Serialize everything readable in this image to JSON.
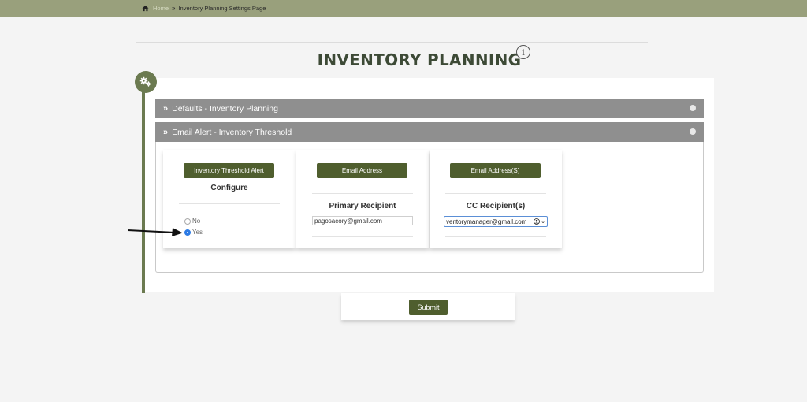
{
  "breadcrumb": {
    "home_label": "Home",
    "separator": "»",
    "current_label": "Inventory Planning Settings Page"
  },
  "page": {
    "title": "INVENTORY PLANNING",
    "info_glyph": "i"
  },
  "accordions": [
    {
      "label": "Defaults - Inventory Planning",
      "chevron": "»"
    },
    {
      "label": "Email Alert - Inventory Threshold",
      "chevron": "»"
    }
  ],
  "columns": {
    "configure": {
      "button_label": "Inventory Threshold Alert",
      "title": "Configure",
      "options": [
        {
          "label": "No",
          "selected": false
        },
        {
          "label": "Yes",
          "selected": true
        }
      ]
    },
    "primary": {
      "button_label": "Email Address",
      "title": "Primary Recipient",
      "input_value": "pagosacory@gmail.com"
    },
    "cc": {
      "button_label": "Email Address(S)",
      "title": "CC Recipient(s)",
      "select_value": "ventorymanager@gmail.com",
      "caret": "⌄"
    }
  },
  "submit_label": "Submit",
  "colors": {
    "topbar": "#99a07c",
    "accent_green": "#4f5e2e",
    "timeline_green": "#6b7a50",
    "accordion_gray": "#8f8f8f",
    "radio_blue": "#2c7be5"
  }
}
